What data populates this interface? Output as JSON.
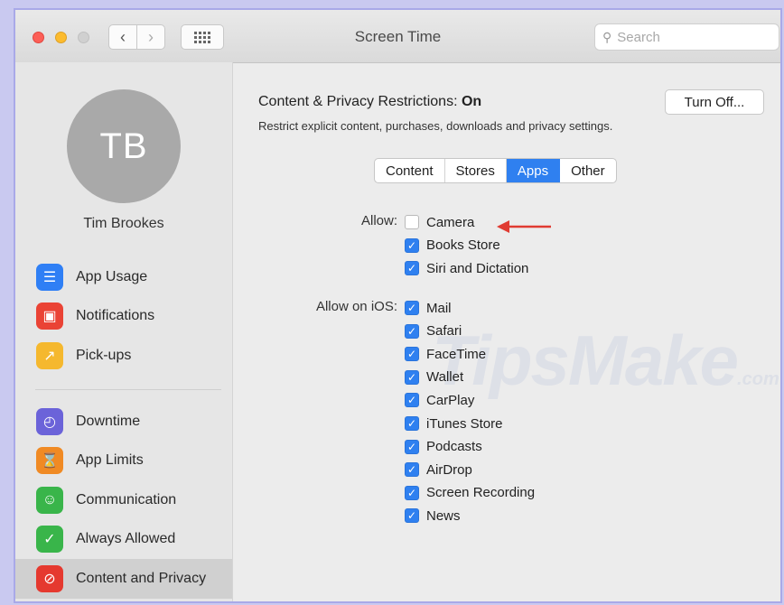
{
  "window": {
    "title": "Screen Time",
    "search_placeholder": "Search"
  },
  "user": {
    "initials": "TB",
    "name": "Tim Brookes"
  },
  "sidebar": {
    "items": [
      {
        "label": "App Usage",
        "icon": "layers-icon",
        "color": "#2f7ff5"
      },
      {
        "label": "Notifications",
        "icon": "notification-icon",
        "color": "#ea4335"
      },
      {
        "label": "Pick-ups",
        "icon": "pickup-icon",
        "color": "#f5b82e"
      },
      {
        "label": "Downtime",
        "icon": "downtime-icon",
        "color": "#6b63d9"
      },
      {
        "label": "App Limits",
        "icon": "hourglass-icon",
        "color": "#f08a24"
      },
      {
        "label": "Communication",
        "icon": "communication-icon",
        "color": "#39b54a"
      },
      {
        "label": "Always Allowed",
        "icon": "checkmark-badge-icon",
        "color": "#39b54a"
      },
      {
        "label": "Content and Privacy",
        "icon": "restricted-icon",
        "color": "#e5392f"
      }
    ]
  },
  "content": {
    "title_prefix": "Content & Privacy Restrictions: ",
    "title_status": "On",
    "subtitle": "Restrict explicit content, purchases, downloads and privacy settings.",
    "turn_off_label": "Turn Off...",
    "tabs": [
      "Content",
      "Stores",
      "Apps",
      "Other"
    ],
    "active_tab": "Apps",
    "allow_label": "Allow:",
    "allow_items": [
      {
        "label": "Camera",
        "checked": false
      },
      {
        "label": "Books Store",
        "checked": true
      },
      {
        "label": "Siri and Dictation",
        "checked": true
      }
    ],
    "allow_ios_label": "Allow on iOS:",
    "allow_ios_items": [
      {
        "label": "Mail",
        "checked": true
      },
      {
        "label": "Safari",
        "checked": true
      },
      {
        "label": "FaceTime",
        "checked": true
      },
      {
        "label": "Wallet",
        "checked": true
      },
      {
        "label": "CarPlay",
        "checked": true
      },
      {
        "label": "iTunes Store",
        "checked": true
      },
      {
        "label": "Podcasts",
        "checked": true
      },
      {
        "label": "AirDrop",
        "checked": true
      },
      {
        "label": "Screen Recording",
        "checked": true
      },
      {
        "label": "News",
        "checked": true
      }
    ]
  },
  "watermark": {
    "text": "TipsMake",
    "suffix": ".com"
  },
  "colors": {
    "accent": "#2f80f0",
    "arrow": "#e03b32"
  }
}
